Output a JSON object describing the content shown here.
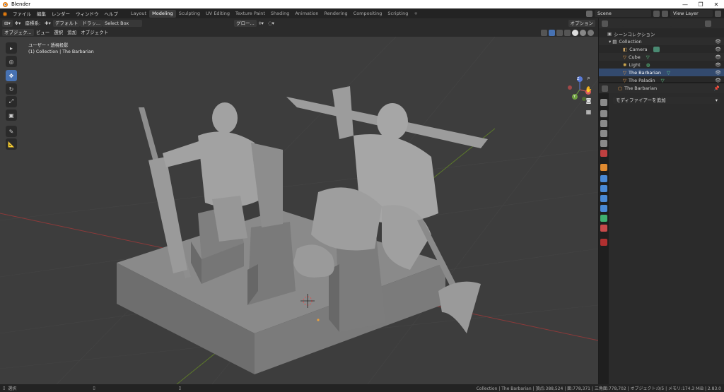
{
  "window": {
    "title": "Blender",
    "controls": [
      "—",
      "❐",
      "✕"
    ]
  },
  "menu": [
    "ファイル",
    "編集",
    "レンダー",
    "ウィンドウ",
    "ヘルプ"
  ],
  "workspaces": [
    {
      "label": "Layout",
      "active": false
    },
    {
      "label": "Modeling",
      "active": true
    },
    {
      "label": "Sculpting",
      "active": false
    },
    {
      "label": "UV Editing",
      "active": false
    },
    {
      "label": "Texture Paint",
      "active": false
    },
    {
      "label": "Shading",
      "active": false
    },
    {
      "label": "Animation",
      "active": false
    },
    {
      "label": "Rendering",
      "active": false
    },
    {
      "label": "Compositing",
      "active": false
    },
    {
      "label": "Scripting",
      "active": false
    }
  ],
  "add_workspace": "+",
  "scene": {
    "label": "Scene"
  },
  "view_layer": {
    "label": "View Layer"
  },
  "header": {
    "coord_label": "座標系:",
    "default_label": "デフォルト",
    "drag_label": "ドラッ...",
    "select_box": "Select Box",
    "global_label": "グロー...",
    "options_label": "オプション"
  },
  "header2": {
    "mode": "オブジェク...",
    "view": "ビュー",
    "select": "選択",
    "add": "追加",
    "object": "オブジェクト"
  },
  "viewport": {
    "line1": "ユーザー・透視投影",
    "line2": "(1) Collection | The Barbarian",
    "axis_x": "X",
    "axis_y": "Y",
    "axis_z": "Z"
  },
  "outliner": {
    "root": "シーンコレクション",
    "collection": "Collection",
    "items": [
      {
        "name": "Camera",
        "color": "#c8a060"
      },
      {
        "name": "Cube",
        "color": "#e49a48"
      },
      {
        "name": "Light",
        "color": "#d8b050"
      },
      {
        "name": "The Barbarian",
        "color": "#e49a48"
      },
      {
        "name": "The Paladin",
        "color": "#e49a48"
      }
    ]
  },
  "properties": {
    "object_name": "The Barbarian",
    "add_modifier": "モディファイアーを追加"
  },
  "status": {
    "left": "選択",
    "right": "Collection | The Barbarian | 頂点:388,524 | 面:778,371 | 三角面:778,702 | オブジェクト:0/5 | メモリ:174.3 MiB | 2.83.0"
  },
  "colors": {
    "accent": "#4772b3",
    "viewport_bg": "#3d3d3d",
    "grid_red": "#8c3a3a",
    "grid_green": "#5d7a2a"
  }
}
